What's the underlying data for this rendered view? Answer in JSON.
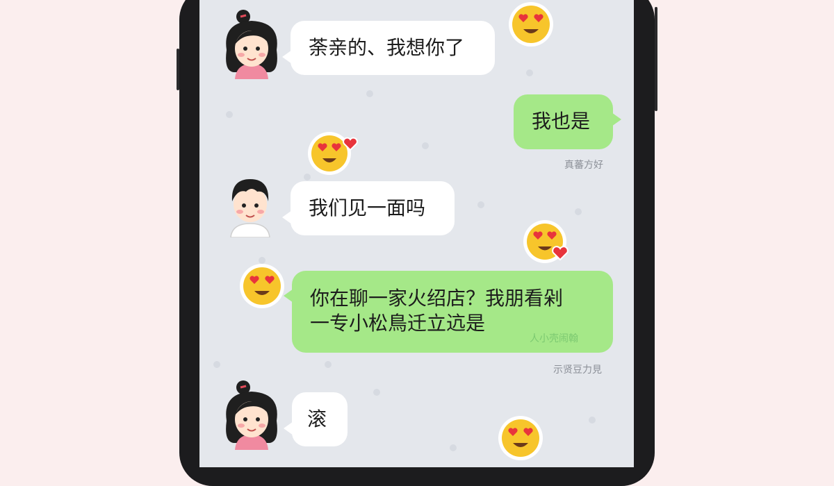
{
  "chat": {
    "messages": [
      {
        "text": "荼亲的、我想你了"
      },
      {
        "text": "我也是",
        "time": "真蕃方好"
      },
      {
        "text": "我们见一面吗"
      },
      {
        "text_line1": "你在聊一家火绍店？我朋看剁",
        "text_line2": "一专小松鳥迁立迒是",
        "watermark": "人小壳闹翰",
        "time": "示贤豆力見"
      },
      {
        "text": "滚"
      }
    ]
  },
  "icons": {
    "emoji_heart_eyes": "heart-eyes-emoji",
    "avatar_girl": "avatar-girl",
    "avatar_boy": "avatar-boy"
  },
  "colors": {
    "bubble_white": "#ffffff",
    "bubble_green": "#a5e888",
    "screen_bg": "#e4e7ec",
    "page_bg": "#fbeeee"
  }
}
